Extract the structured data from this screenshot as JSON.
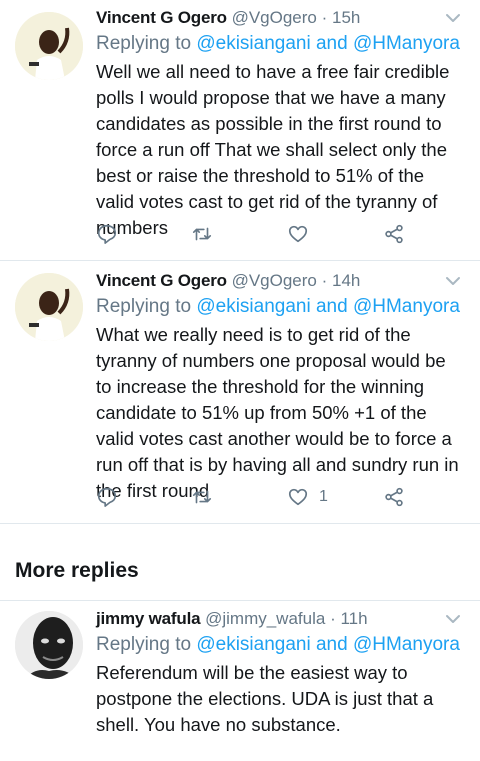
{
  "replies": [
    {
      "name": "Vincent G Ogero",
      "handle": "@VgOgero",
      "time": "15h",
      "replying_prefix": "Replying to",
      "mention_1": "@ekisiangani",
      "and": "and",
      "mention_2": "@HManyora",
      "text": "Well we all need to have a free fair credible polls I would propose that we have a many candidates as possible in the first round to force a run off That we shall select only the best or raise the threshold to 51% of the valid votes cast to get rid of the tyranny of numbers",
      "like_count": ""
    },
    {
      "name": "Vincent G Ogero",
      "handle": "@VgOgero",
      "time": "14h",
      "replying_prefix": "Replying to",
      "mention_1": "@ekisiangani",
      "and": "and",
      "mention_2": "@HManyora",
      "text": "What we really need is to get rid of the tyranny of numbers one proposal would be to increase the threshold for the winning candidate to 51% up from 50% +1 of the valid votes cast another would be to force a run off that is by having all and sundry run in the first round",
      "like_count": "1"
    }
  ],
  "more_replies_heading": "More replies",
  "more": [
    {
      "name": "jimmy wafula",
      "handle": "@jimmy_wafula",
      "time": "11h",
      "replying_prefix": "Replying to",
      "mention_1": "@ekisiangani",
      "and": "and",
      "mention_2": "@HManyora",
      "text": "Referendum will be the easiest way to postpone the elections. UDA is just that a shell. You have no substance."
    }
  ],
  "separator": "·",
  "colors": {
    "link": "#1da1f2",
    "muted": "#657786",
    "text": "#14171a",
    "divider": "#e1e8ed"
  },
  "icons": [
    "reply-icon",
    "retweet-icon",
    "like-icon",
    "share-icon",
    "chevron-down-icon"
  ]
}
